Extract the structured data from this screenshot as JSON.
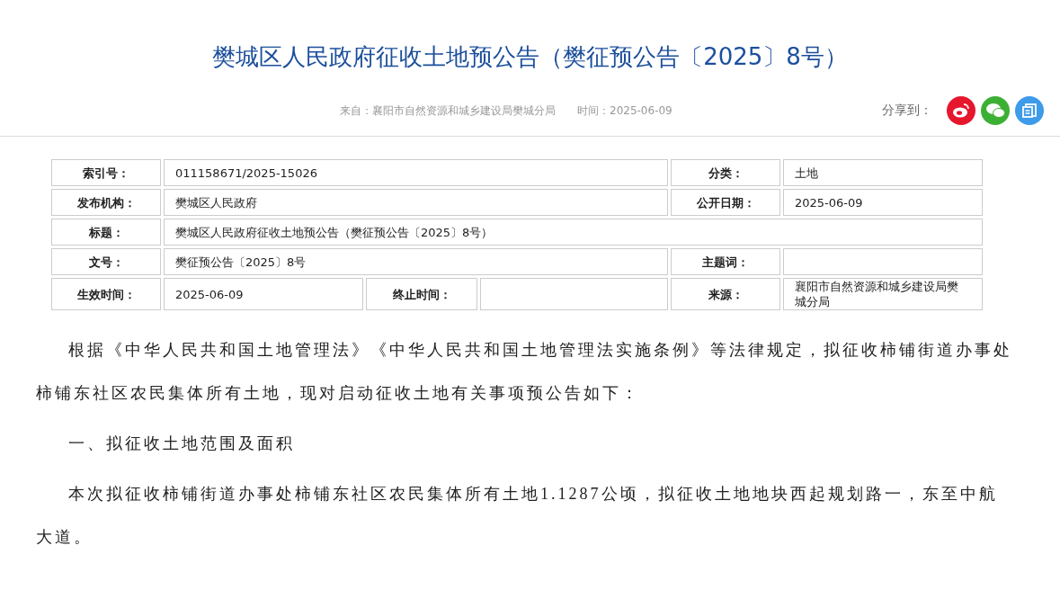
{
  "title": "樊城区人民政府征收土地预公告（樊征预公告〔2025〕8号）",
  "meta": {
    "source": "来自：襄阳市自然资源和城乡建设局樊城分局",
    "time": "时间：2025-06-09"
  },
  "share": {
    "label": "分享到：",
    "targets": [
      {
        "kind": "weibo",
        "color": "#e6162d"
      },
      {
        "kind": "wechat",
        "color": "#3cb034"
      },
      {
        "kind": "copy",
        "color": "#3d9be9"
      }
    ]
  },
  "info_table": {
    "rows": [
      [
        {
          "kind": "label",
          "text": "索引号："
        },
        {
          "kind": "value",
          "text": "011158671/2025-15026"
        },
        {
          "kind": "label",
          "text": "分类："
        },
        {
          "kind": "value",
          "text": "土地"
        }
      ],
      [
        {
          "kind": "label",
          "text": "发布机构："
        },
        {
          "kind": "value",
          "text": "樊城区人民政府"
        },
        {
          "kind": "label",
          "text": "公开日期："
        },
        {
          "kind": "value",
          "text": "2025-06-09"
        }
      ],
      [
        {
          "kind": "label",
          "text": "标题："
        },
        {
          "kind": "value",
          "text": "樊城区人民政府征收土地预公告（樊征预公告〔2025〕8号）"
        }
      ],
      [
        {
          "kind": "label",
          "text": "文号："
        },
        {
          "kind": "value",
          "text": "樊征预公告〔2025〕8号"
        },
        {
          "kind": "label",
          "text": "主题词："
        },
        {
          "kind": "value",
          "text": ""
        }
      ],
      [
        {
          "kind": "label",
          "text": "生效时间："
        },
        {
          "kind": "value",
          "text": "2025-06-09"
        },
        {
          "kind": "label",
          "text": "终止时间："
        },
        {
          "kind": "value",
          "text": ""
        },
        {
          "kind": "label",
          "text": "来源："
        },
        {
          "kind": "value",
          "text": "襄阳市自然资源和城乡建设局樊城分局"
        }
      ]
    ]
  },
  "paragraphs": [
    "根据《中华人民共和国土地管理法》《中华人民共和国土地管理法实施条例》等法律规定，拟征收柿铺街道办事处柿铺东社区农民集体所有土地，现对启动征收土地有关事项预公告如下：",
    "一、拟征收土地范围及面积",
    "本次拟征收柿铺街道办事处柿铺东社区农民集体所有土地1.1287公顷，拟征收土地地块西起规划路一，东至中航大道。"
  ]
}
